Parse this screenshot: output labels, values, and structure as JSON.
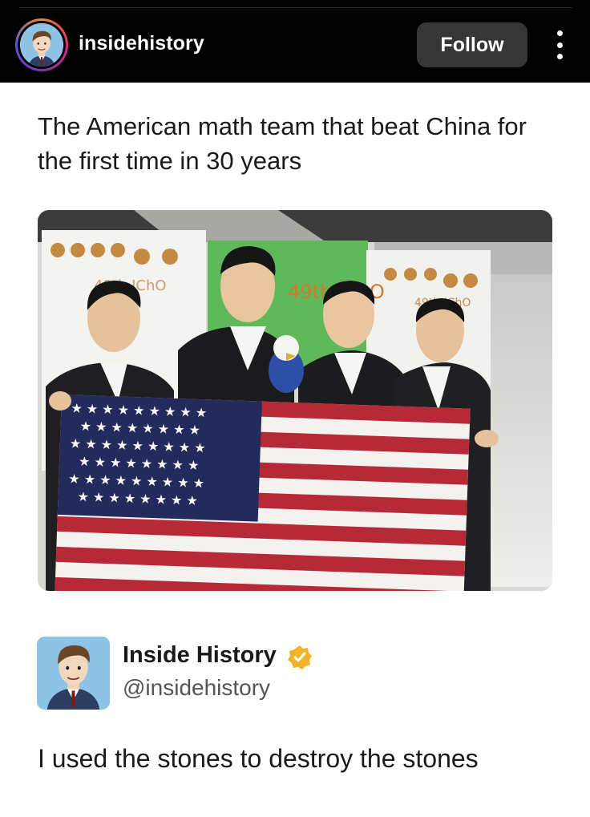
{
  "header": {
    "username": "insidehistory",
    "follow_label": "Follow",
    "more_icon": "more-vertical-icon"
  },
  "post": {
    "caption": "The American math team that beat China for the first time in 30 years",
    "photo_signs": {
      "left_banner": "49th IChO",
      "center_banner": "49th IChO",
      "right_banner": "49th IChO"
    }
  },
  "tweet": {
    "display_name": "Inside History",
    "handle": "@insidehistory",
    "text": "I used the stones to destroy the stones",
    "verified_icon": "verified-badge-icon",
    "verified_color": "#f0b429"
  },
  "colors": {
    "topbar_bg": "#000000",
    "follow_bg": "#363636",
    "avatar_bg": "#8fc3e6"
  }
}
